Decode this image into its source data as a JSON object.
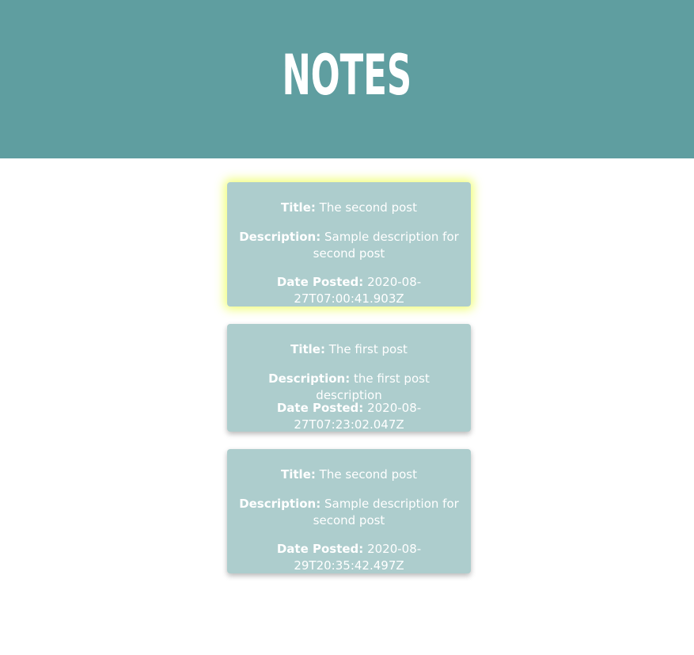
{
  "header": {
    "title": "NOTES"
  },
  "labels": {
    "title": "Title:",
    "description": "Description:",
    "date_posted": "Date Posted:"
  },
  "notes": [
    {
      "title": "The second post",
      "description": "Sample description for second post",
      "date_posted": "2020-08-27T07:00:41.903Z"
    },
    {
      "title": "The first post",
      "description": "the first post description",
      "date_posted": "2020-08-27T07:23:02.047Z"
    },
    {
      "title": "The second post",
      "description": "Sample description for second post",
      "date_posted": "2020-08-29T20:35:42.497Z"
    }
  ],
  "colors": {
    "header_bg": "#5f9ea0",
    "card_bg": "#adcdcd",
    "highlight_glow": "#eeff69",
    "text": "#ffffff"
  }
}
